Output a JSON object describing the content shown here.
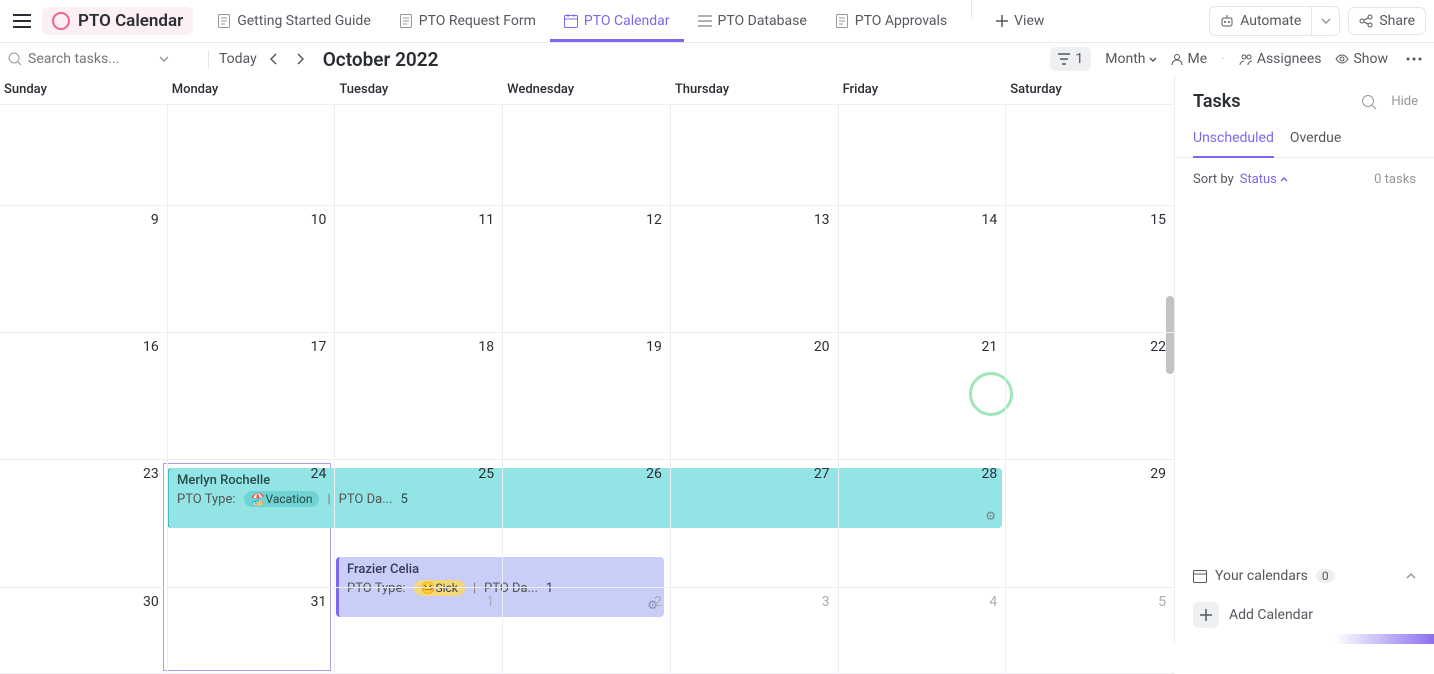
{
  "workspace": {
    "name": "PTO Calendar"
  },
  "tabs": [
    {
      "label": "Getting Started Guide"
    },
    {
      "label": "PTO Request Form"
    },
    {
      "label": "PTO Calendar"
    },
    {
      "label": "PTO Database"
    },
    {
      "label": "PTO Approvals"
    }
  ],
  "add_view": "View",
  "automate": "Automate",
  "share": "Share",
  "toolbar": {
    "search_placeholder": "Search tasks...",
    "today": "Today",
    "month_label": "October 2022",
    "filter_count": "1",
    "view_scale": "Month",
    "me": "Me",
    "assignees": "Assignees",
    "show": "Show"
  },
  "days": [
    "Sunday",
    "Monday",
    "Tuesday",
    "Wednesday",
    "Thursday",
    "Friday",
    "Saturday"
  ],
  "grid": [
    [
      {
        "n": ""
      },
      {
        "n": ""
      },
      {
        "n": ""
      },
      {
        "n": ""
      },
      {
        "n": ""
      },
      {
        "n": ""
      },
      {
        "n": ""
      }
    ],
    [
      {
        "n": "9"
      },
      {
        "n": "10"
      },
      {
        "n": "11"
      },
      {
        "n": "12"
      },
      {
        "n": "13"
      },
      {
        "n": "14"
      },
      {
        "n": "15"
      }
    ],
    [
      {
        "n": "16"
      },
      {
        "n": "17"
      },
      {
        "n": "18"
      },
      {
        "n": "19"
      },
      {
        "n": "20"
      },
      {
        "n": "21"
      },
      {
        "n": "22"
      }
    ],
    [
      {
        "n": "23"
      },
      {
        "n": "24"
      },
      {
        "n": "25"
      },
      {
        "n": "26"
      },
      {
        "n": "27"
      },
      {
        "n": "28"
      },
      {
        "n": "29"
      }
    ],
    [
      {
        "n": "30"
      },
      {
        "n": "31"
      },
      {
        "n": "1",
        "dim": true
      },
      {
        "n": "2",
        "dim": true
      },
      {
        "n": "3",
        "dim": true
      },
      {
        "n": "4",
        "dim": true
      },
      {
        "n": "5",
        "dim": true
      }
    ]
  ],
  "events": [
    {
      "name": "Merlyn Rochelle",
      "type_label": "PTO Type:",
      "tag": "🏖️Vacation",
      "days_label": "PTO Da...",
      "days": "5"
    },
    {
      "name": "Frazier Celia",
      "type_label": "PTO Type:",
      "tag": "🤒Sick",
      "days_label": "PTO Da...",
      "days": "1"
    }
  ],
  "side": {
    "title": "Tasks",
    "hide": "Hide",
    "tabs": [
      "Unscheduled",
      "Overdue"
    ],
    "sort_by": "Sort by",
    "sort_val": "Status",
    "count_num": "0",
    "count_word": "tasks",
    "your_cal": "Your calendars",
    "your_cal_count": "0",
    "add_cal": "Add Calendar"
  }
}
